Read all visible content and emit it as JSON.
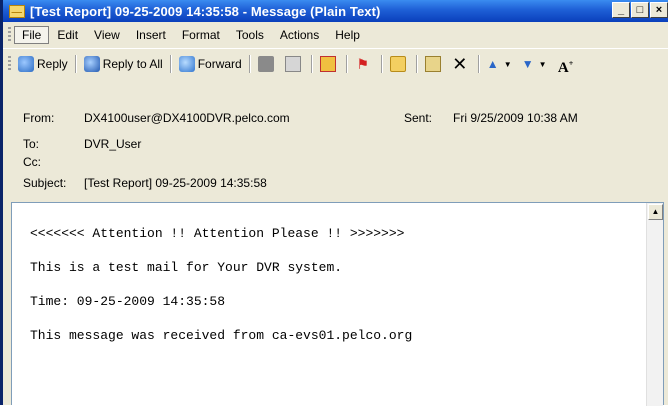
{
  "window": {
    "title": "[Test Report] 09-25-2009 14:35:58  - Message (Plain Text)",
    "buttons": {
      "minimize": "_",
      "maximize": "□",
      "close": "×"
    }
  },
  "menu": {
    "items": [
      "File",
      "Edit",
      "View",
      "Insert",
      "Format",
      "Tools",
      "Actions",
      "Help"
    ],
    "active": "File"
  },
  "toolbar": {
    "reply": "Reply",
    "reply_all": "Reply to All",
    "forward": "Forward"
  },
  "header": {
    "from_label": "From:",
    "from_value": "DX4100user@DX4100DVR.pelco.com",
    "sent_label": "Sent:",
    "sent_value": "Fri 9/25/2009 10:38 AM",
    "to_label": "To:",
    "to_value": "DVR_User",
    "cc_label": "Cc:",
    "cc_value": "",
    "subject_label": "Subject:",
    "subject_value": "[Test Report] 09-25-2009 14:35:58"
  },
  "body": {
    "lines": [
      "<<<<<<< Attention !! Attention Please !! >>>>>>>",
      "This is a test mail for Your DVR system.",
      "Time: 09-25-2009 14:35:58",
      "This message was received from ca-evs01.pelco.org"
    ]
  },
  "colors": {
    "titlebar": "#1e5fd6",
    "chrome": "#ece9d8",
    "body_border": "#7f9db9"
  }
}
